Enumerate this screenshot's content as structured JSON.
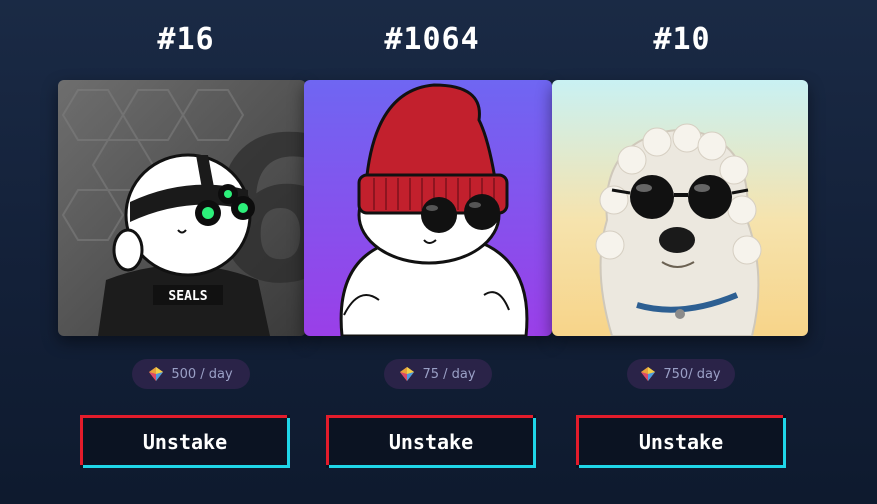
{
  "cards": [
    {
      "title": "#16",
      "image": "seal-with-night-vision-goggles",
      "badge_text": "SEALS",
      "reward": "500 / day",
      "button": "Unstake"
    },
    {
      "title": "#1064",
      "image": "seal-with-red-beanie-and-sunglasses",
      "reward": "75 / day",
      "button": "Unstake"
    },
    {
      "title": "#10",
      "image": "white-dog-with-sunglasses",
      "reward": "750/ day",
      "button": "Unstake"
    }
  ],
  "colors": {
    "background": "#152339",
    "button_red": "#e31c2b",
    "button_cyan": "#1fd6e8",
    "reward_pill": "#2a2348",
    "reward_text": "#9aa0c6"
  },
  "icons": {
    "reward": "gem-icon"
  }
}
